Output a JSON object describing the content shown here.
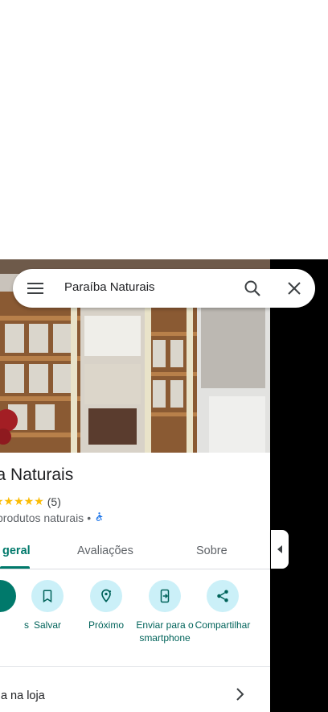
{
  "search": {
    "query": "Paraíba Naturais"
  },
  "place": {
    "name": "íba Naturais",
    "rating_stars": "★★★★★",
    "review_count": "(5)",
    "category": "produtos naturais",
    "separator": "•"
  },
  "tabs": [
    {
      "label": "geral",
      "active": true
    },
    {
      "label": "Avaliações",
      "active": false
    },
    {
      "label": "Sobre",
      "active": false
    }
  ],
  "actions": [
    {
      "label": "s"
    },
    {
      "label": "Salvar"
    },
    {
      "label": "Próximo"
    },
    {
      "label": "Enviar para o smartphone"
    },
    {
      "label": "Compartilhar"
    }
  ],
  "info_rows": [
    {
      "label": "rada na loja"
    }
  ],
  "colors": {
    "accent": "#00796b",
    "action_bg": "#cbf0f8",
    "star": "#fbbc04",
    "accessibility": "#1a73e8"
  },
  "icons": {
    "menu": "menu-icon",
    "search": "search-icon",
    "close": "close-icon",
    "save": "bookmark-icon",
    "nearby": "nearby-icon",
    "send": "send-to-phone-icon",
    "share": "share-icon",
    "chevron": "chevron-right-icon",
    "collapse": "caret-left-icon",
    "accessibility": "wheelchair-icon"
  }
}
